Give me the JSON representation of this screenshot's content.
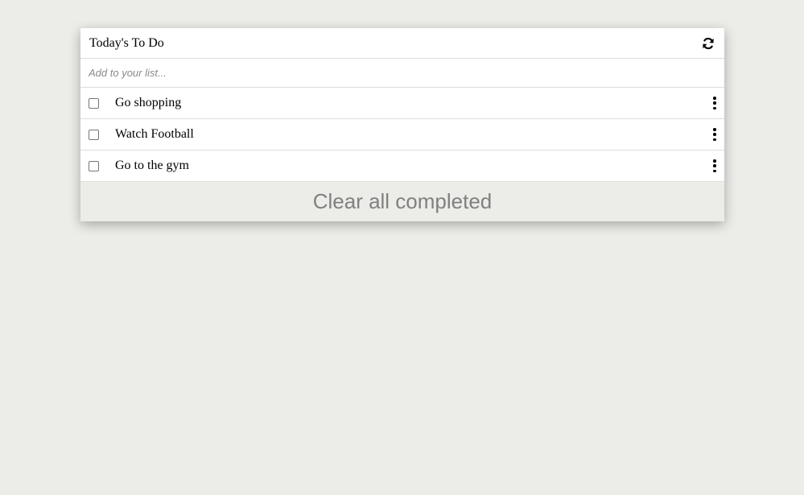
{
  "header": {
    "title": "Today's To Do"
  },
  "add_field": {
    "placeholder": "Add to your list...",
    "value": ""
  },
  "items": [
    {
      "label": "Go shopping",
      "checked": false
    },
    {
      "label": "Watch Football",
      "checked": false
    },
    {
      "label": "Go to the gym",
      "checked": false
    }
  ],
  "footer": {
    "clear_label": "Clear all completed"
  },
  "icons": {
    "refresh": "refresh-icon",
    "more": "more-vertical-icon"
  },
  "colors": {
    "page_background": "#ecece8",
    "card_background": "#ffffff",
    "footer_text": "#808080"
  }
}
